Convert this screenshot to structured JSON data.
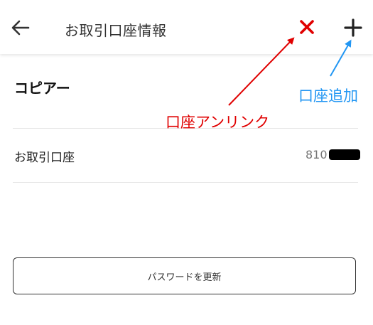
{
  "header": {
    "title": "お取引口座情報",
    "back_icon": "arrow-left-icon",
    "close_icon": "close-x-icon",
    "add_icon": "plus-icon"
  },
  "section": {
    "title": "コピアー"
  },
  "account_row": {
    "label": "お取引口座",
    "value_prefix": "810"
  },
  "update_button": {
    "label": "パスワードを更新"
  },
  "annotations": {
    "unlink": "口座アンリンク",
    "add": "口座追加"
  },
  "colors": {
    "annotation_red": "#e00000",
    "annotation_blue": "#2196f3",
    "close_icon": "#e00000"
  }
}
